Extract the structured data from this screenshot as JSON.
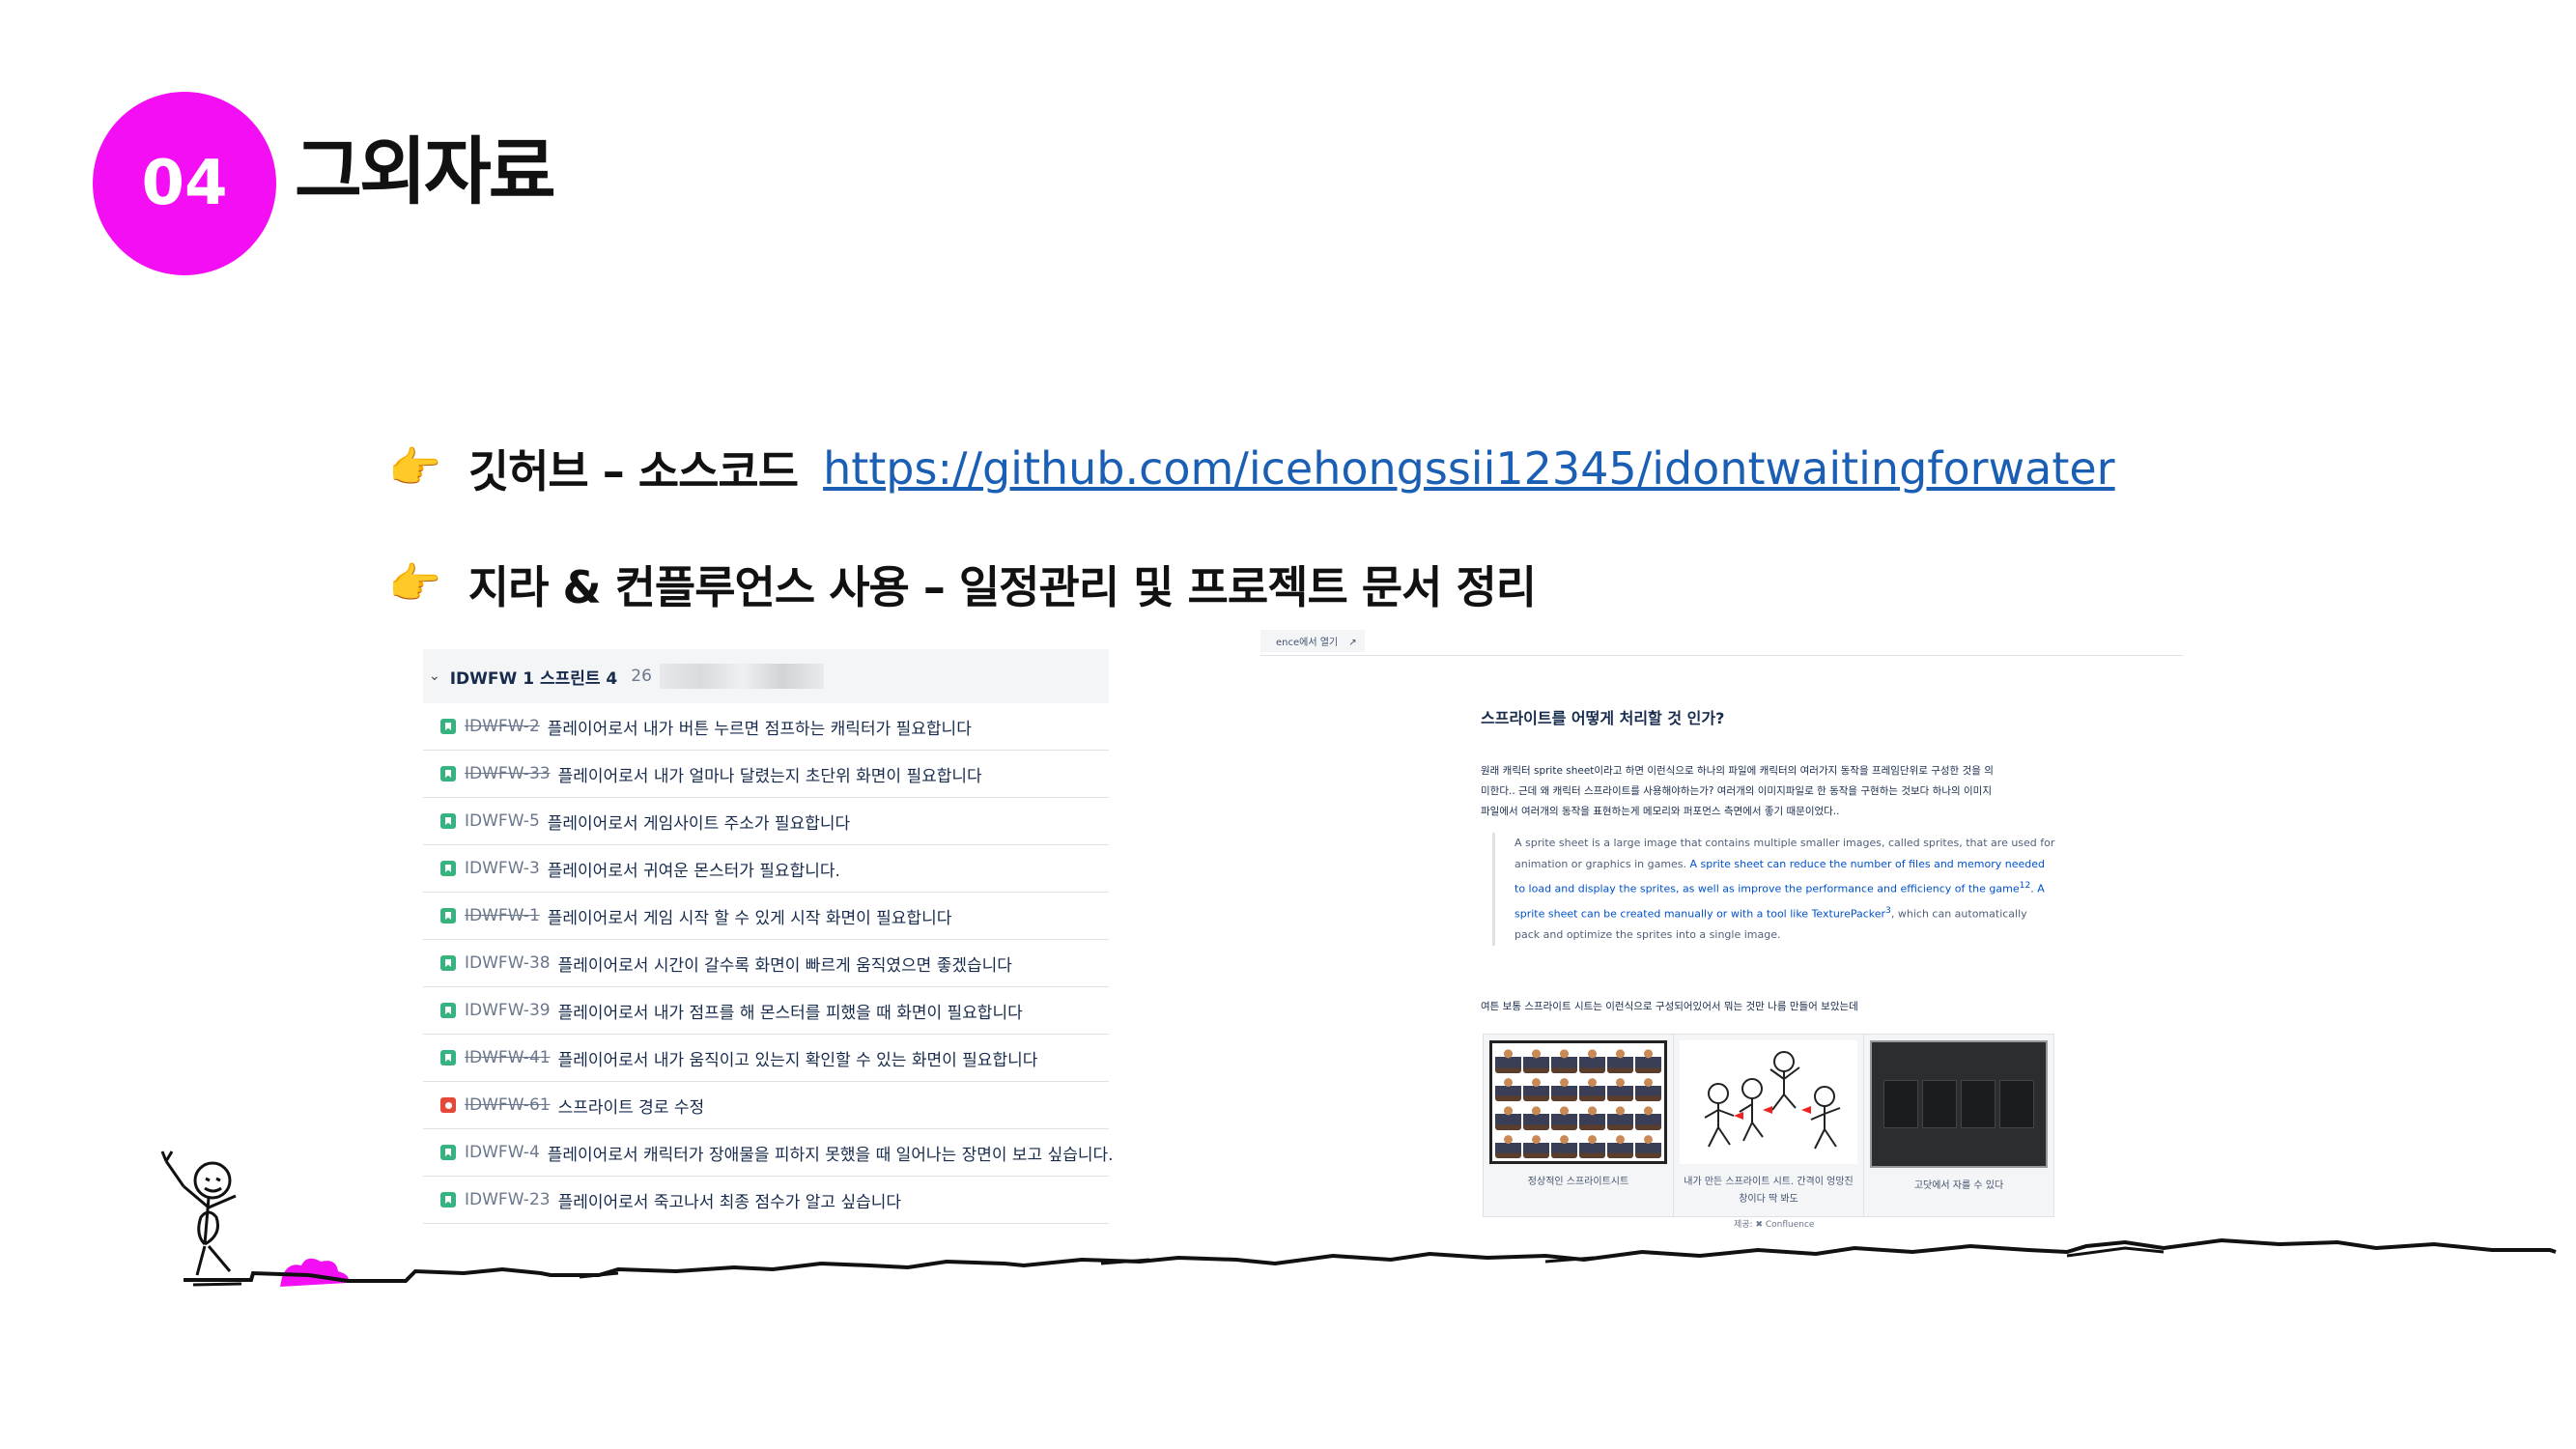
{
  "badge": {
    "number": "04"
  },
  "title": "그외자료",
  "bullets": [
    {
      "icon": "👉",
      "label": "깃허브 – 소스코드",
      "link": "https://github.com/icehongssii12345/idontwaitingforwater"
    },
    {
      "icon": "👉",
      "label": "지라 & 컨플루언스 사용 – 일정관리 및 프로젝트 문서 정리"
    }
  ],
  "jira": {
    "sprint_name": "IDWFW 1 스프린트 4",
    "sprint_count": "26",
    "rows": [
      {
        "key": "IDWFW-2",
        "done": true,
        "type": "story",
        "summary": "플레이어로서 내가 버튼 누르면 점프하는 캐릭터가 필요합니다"
      },
      {
        "key": "IDWFW-33",
        "done": true,
        "type": "story",
        "summary": "플레이어로서 내가 얼마나 달렸는지 초단위 화면이 필요합니다"
      },
      {
        "key": "IDWFW-5",
        "done": false,
        "type": "story",
        "summary": "플레이어로서 게임사이트 주소가 필요합니다"
      },
      {
        "key": "IDWFW-3",
        "done": false,
        "type": "story",
        "summary": "플레이어로서 귀여운 몬스터가 필요합니다."
      },
      {
        "key": "IDWFW-1",
        "done": true,
        "type": "story",
        "summary": "플레이어로서 게임 시작 할 수 있게 시작 화면이 필요합니다"
      },
      {
        "key": "IDWFW-38",
        "done": false,
        "type": "story",
        "summary": "플레이어로서 시간이 갈수록 화면이 빠르게 움직였으면 좋겠습니다"
      },
      {
        "key": "IDWFW-39",
        "done": false,
        "type": "story",
        "summary": "플레이어로서 내가 점프를 해 몬스터를 피했을 때 화면이 필요합니다"
      },
      {
        "key": "IDWFW-41",
        "done": true,
        "type": "story",
        "summary": "플레이어로서 내가 움직이고 있는지 확인할 수 있는 화면이 필요합니다"
      },
      {
        "key": "IDWFW-61",
        "done": true,
        "type": "bug",
        "summary": "스프라이트 경로 수정"
      },
      {
        "key": "IDWFW-4",
        "done": false,
        "type": "story",
        "summary": "플레이어로서 캐릭터가 장애물을 피하지 못했을 때 일어나는 장면이 보고 싶습니다."
      },
      {
        "key": "IDWFW-23",
        "done": false,
        "type": "story",
        "summary": "플레이어로서 죽고나서 최종 점수가 알고 싶습니다"
      }
    ]
  },
  "confluence": {
    "open_label": "ence에서 열기",
    "heading": "스프라이트를 어떻게 처리할 것 인가?",
    "para_lines": [
      "원래 캐릭터 sprite sheet이라고 하면 이런식으로 하나의 파일에 캐릭터의 여러가지 동작을 프레임단위로 구성한 것을 의",
      "미한다.. 근데 왜 캐릭터 스프라이트를 사용해야하는가? 여러개의 이미지파일로 한 동작을 구현하는 것보다 하나의 이미지",
      "파일에서 여러개의 동작을 표현하는게 메모리와 퍼포먼스 측면에서 좋기 때문이었다.."
    ],
    "quote_plain_1": "A sprite sheet is a large image that contains multiple smaller images, called sprites, that are used for animation or graphics in games.",
    "quote_highlight_1": "A sprite sheet can reduce the number of files and memory needed to load and display the sprites, as well as improve the performance and efficiency of the game",
    "quote_sup_1": "12",
    "quote_highlight_2": "A sprite sheet can be created manually or with a tool like TexturePacker",
    "quote_sup_2": "3",
    "quote_plain_2": ", which can automatically pack and optimize the sprites into a single image.",
    "sub": "여튼 보통 스프라이트 시트는 이런식으로 구성되어있어서 뭐는 것만 나름 만들어 보았는데",
    "gallery": [
      {
        "caption": "정상적인 스프라이트시트"
      },
      {
        "caption": "내가 만든 스프라이트 시트. 간격이 엉망진창이다 딱 봐도"
      },
      {
        "caption": "고닷에서 자를 수 있다"
      }
    ],
    "footer": "제공: ✖ Confluence"
  },
  "colors": {
    "accent": "#f40ef4",
    "link": "#1a5fb4",
    "story": "#36b37e",
    "bug": "#e5493a"
  }
}
